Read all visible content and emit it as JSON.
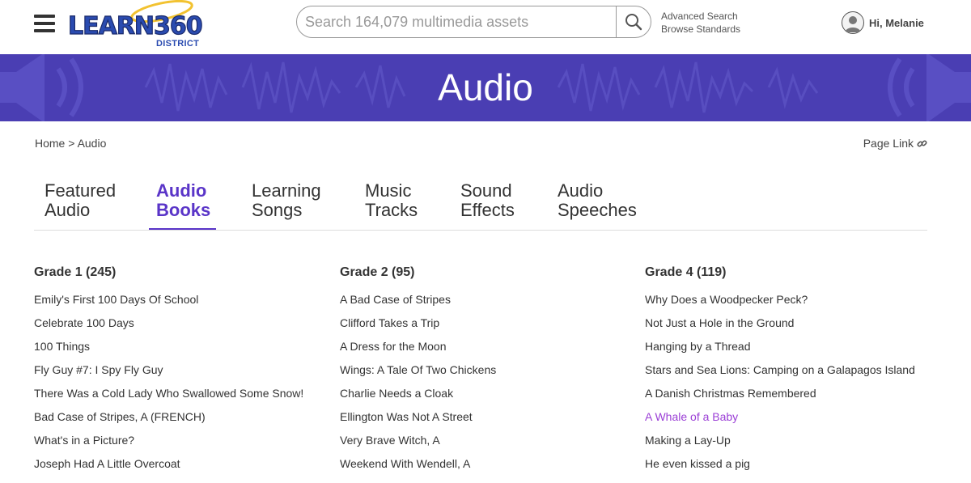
{
  "header": {
    "logo_text": "LEARN360",
    "logo_subtext": "DISTRICT",
    "search_placeholder": "Search 164,079 multimedia assets",
    "advanced_search": "Advanced Search",
    "browse_standards": "Browse Standards",
    "user_greeting": "Hi, Melanie"
  },
  "banner": {
    "title": "Audio"
  },
  "breadcrumb": {
    "home": "Home",
    "separator": ">",
    "current": "Audio"
  },
  "page_link": "Page Link",
  "tabs": [
    {
      "line1": "Featured",
      "line2": "Audio"
    },
    {
      "line1": "Audio",
      "line2": "Books"
    },
    {
      "line1": "Learning",
      "line2": "Songs"
    },
    {
      "line1": "Music",
      "line2": "Tracks"
    },
    {
      "line1": "Sound",
      "line2": "Effects"
    },
    {
      "line1": "Audio",
      "line2": "Speeches"
    }
  ],
  "active_tab": "Audio Books",
  "columns": [
    {
      "heading": "Grade 1 (245)",
      "items": [
        "Emily's First 100 Days Of School",
        "Celebrate 100 Days",
        "100 Things",
        "Fly Guy #7: I Spy Fly Guy",
        "There Was a Cold Lady Who Swallowed Some Snow!",
        "Bad Case of Stripes, A (FRENCH)",
        "What's in a Picture?",
        "Joseph Had A Little Overcoat"
      ]
    },
    {
      "heading": "Grade 2 (95)",
      "items": [
        "A Bad Case of Stripes",
        "Clifford Takes a Trip",
        "A Dress for the Moon",
        "Wings: A Tale Of Two Chickens",
        "Charlie Needs a Cloak",
        "Ellington Was Not A Street",
        "Very Brave Witch, A",
        "Weekend With Wendell, A"
      ]
    },
    {
      "heading": "Grade 4 (119)",
      "items": [
        "Why Does a Woodpecker Peck?",
        "Not Just a Hole in the Ground",
        "Hanging by a Thread",
        "Stars and Sea Lions: Camping on a Galapagos Island",
        "A Danish Christmas Remembered",
        "A Whale of a Baby",
        "Making a Lay-Up",
        "He even kissed a pig"
      ]
    }
  ],
  "colors": {
    "banner": "#4a3eb3",
    "active_tab": "#5a35c8",
    "highlight_link": "#9b3fd6",
    "logo_blue": "#2a4bb0",
    "logo_yellow": "#f2c230"
  },
  "icons": [
    "menu-icon",
    "search-icon",
    "user-avatar-icon",
    "speaker-icon",
    "link-icon"
  ]
}
